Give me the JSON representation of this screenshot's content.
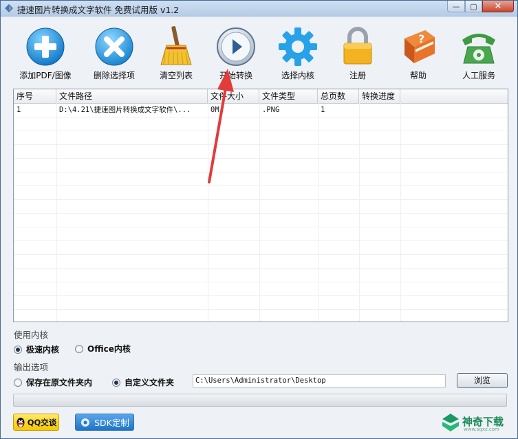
{
  "window": {
    "title": "捷速图片转换成文字软件 免费试用版 v1.2",
    "min_label": "—",
    "max_label": "▢",
    "close_label": "✕"
  },
  "toolbar": {
    "items": [
      {
        "label": "添加PDF/图像",
        "icon": "add-icon"
      },
      {
        "label": "删除选择项",
        "icon": "delete-icon"
      },
      {
        "label": "清空列表",
        "icon": "broom-icon"
      },
      {
        "label": "开始转换",
        "icon": "play-icon"
      },
      {
        "label": "选择内核",
        "icon": "gear-icon"
      },
      {
        "label": "注册",
        "icon": "lock-icon"
      },
      {
        "label": "帮助",
        "icon": "help-book-icon"
      },
      {
        "label": "人工服务",
        "icon": "telephone-icon"
      }
    ]
  },
  "table": {
    "columns": [
      "序号",
      "文件路径",
      "文件大小",
      "文件类型",
      "总页数",
      "转换进度"
    ],
    "rows": [
      {
        "index": "1",
        "path": "D:\\4.21\\捷速图片转换成文字软件\\...",
        "size": "0M",
        "type": ".PNG",
        "pages": "1",
        "progress": ""
      }
    ]
  },
  "engine": {
    "section_label": "使用内核",
    "options": [
      "极速内核",
      "Office内核"
    ],
    "selected": 0
  },
  "output": {
    "section_label": "输出选项",
    "options": [
      "保存在原文件夹内",
      "自定义文件夹"
    ],
    "selected": 1,
    "path": "C:\\Users\\Administrator\\Desktop",
    "browse_label": "浏览"
  },
  "progress": {
    "percent": 0
  },
  "footer": {
    "qq_label": "QQ交谈",
    "sdk_label": "SDK定制",
    "watermark_text": "神奇下载",
    "watermark_sub": "www.sqxz.com"
  },
  "colors": {
    "accent_arrow": "#e23b3b",
    "titlebar": "#c2d6ee"
  }
}
